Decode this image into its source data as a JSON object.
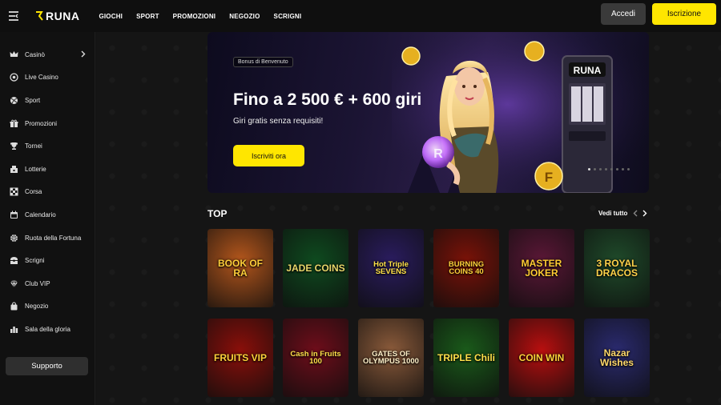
{
  "header": {
    "logo": "RUNA",
    "nav": [
      "GIOCHI",
      "SPORT",
      "PROMOZIONI",
      "NEGOZIO",
      "SCRIGNI"
    ],
    "login_label": "Accedi",
    "signup_label": "Iscrizione"
  },
  "sidebar": {
    "items": [
      {
        "label": "Casinò",
        "icon": "crown-icon"
      },
      {
        "label": "Live Casino",
        "icon": "chip-icon"
      },
      {
        "label": "Sport",
        "icon": "ball-icon"
      },
      {
        "label": "Promozioni",
        "icon": "gift-icon"
      },
      {
        "label": "Tornei",
        "icon": "trophy-icon"
      },
      {
        "label": "Lotterie",
        "icon": "ticket-icon"
      },
      {
        "label": "Corsa",
        "icon": "race-flag-icon"
      },
      {
        "label": "Calendario",
        "icon": "calendar-icon"
      },
      {
        "label": "Ruota della Fortuna",
        "icon": "wheel-icon"
      },
      {
        "label": "Scrigni",
        "icon": "chest-icon"
      },
      {
        "label": "Club VIP",
        "icon": "vip-icon"
      },
      {
        "label": "Negozio",
        "icon": "bag-icon"
      },
      {
        "label": "Sala della gloria",
        "icon": "hall-icon"
      }
    ],
    "support_label": "Supporto"
  },
  "banner": {
    "badge": "Bonus di Benvenuto",
    "title": "Fino a 2 500 € + 600 giri",
    "subtitle": "Giri gratis senza requisiti!",
    "cta": "Iscriviti ora",
    "slot_logo": "RUNA",
    "coin_letter": "F",
    "orb_letter": "R",
    "slides_total": 8,
    "slides_active": 1
  },
  "top_section": {
    "title": "TOP",
    "see_all": "Vedi tutto"
  },
  "games": [
    {
      "name": "BOOK OF RA",
      "bg": "#b3561c",
      "color": "#ffcf3a"
    },
    {
      "name": "JADE COINS",
      "bg": "#0e4a1f",
      "color": "#e8d66a"
    },
    {
      "name": "Hot Triple SEVENS",
      "bg": "#2a1c5e",
      "color": "#ffe14a"
    },
    {
      "name": "BURNING COINS 40",
      "bg": "#7a1208",
      "color": "#ffd23a"
    },
    {
      "name": "MASTER JOKER",
      "bg": "#5a1736",
      "color": "#ffcc33"
    },
    {
      "name": "3 ROYAL DRACOS",
      "bg": "#1f4a2a",
      "color": "#ffd24a"
    },
    {
      "name": "FRUITS VIP",
      "bg": "#8a0f0a",
      "color": "#ffd23a"
    },
    {
      "name": "Cash in Fruits 100",
      "bg": "#6e0d1a",
      "color": "#ffe04a"
    },
    {
      "name": "GATES OF OLYMPUS 1000",
      "bg": "#8a5a3a",
      "color": "#fff0c8"
    },
    {
      "name": "TRIPLE Chili",
      "bg": "#1a5a1a",
      "color": "#ffe04a"
    },
    {
      "name": "COIN WIN",
      "bg": "#b80f0f",
      "color": "#ffd23a"
    },
    {
      "name": "Nazar Wishes",
      "bg": "#2a2a6e",
      "color": "#ffd86a"
    }
  ]
}
